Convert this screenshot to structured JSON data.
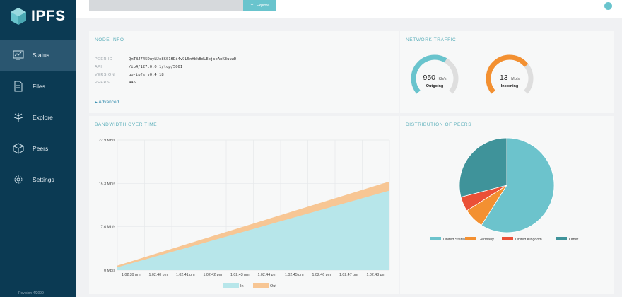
{
  "app": {
    "name": "IPFS",
    "footer": "Revision 4f2099"
  },
  "nav": [
    {
      "id": "status",
      "label": "Status",
      "icon": "monitor-icon",
      "active": true
    },
    {
      "id": "files",
      "label": "Files",
      "icon": "file-icon",
      "active": false
    },
    {
      "id": "explore",
      "label": "Explore",
      "icon": "tree-icon",
      "active": false
    },
    {
      "id": "peers",
      "label": "Peers",
      "icon": "cube-icon",
      "active": false
    },
    {
      "id": "settings",
      "label": "Settings",
      "icon": "gear-icon",
      "active": false
    }
  ],
  "topbar": {
    "search_value": "",
    "explore_label": "Explore"
  },
  "node_info": {
    "title": "Node Info",
    "rows": [
      {
        "key": "Peer ID",
        "value": "QmTBJ745DuyNJo8SS1HDi4v9L5nHbkBdLEojseAnK3uuwD"
      },
      {
        "key": "API",
        "value": "/ip4/127.0.0.1/tcp/5001"
      },
      {
        "key": "Version",
        "value": "go-ipfs v0.4.18"
      },
      {
        "key": "Peers",
        "value": "445"
      }
    ],
    "advanced_label": "Advanced"
  },
  "traffic": {
    "title": "Network Traffic",
    "gauges": [
      {
        "value": "950",
        "unit": "Kb/s",
        "label": "Outgoing",
        "fill": 0.62,
        "color": "#69c4cd"
      },
      {
        "value": "13",
        "unit": "Mb/s",
        "label": "Incoming",
        "fill": 0.7,
        "color": "#f39031"
      }
    ]
  },
  "bandwidth": {
    "title": "Bandwidth over time",
    "legend": [
      {
        "label": "In",
        "color": "#b7e6ea"
      },
      {
        "label": "Out",
        "color": "#f7c694"
      }
    ]
  },
  "distribution": {
    "title": "Distribution of peers"
  },
  "chart_data": [
    {
      "type": "area",
      "title": "Bandwidth over time",
      "x": [
        "1:02:39 pm",
        "1:02:40 pm",
        "1:02:41 pm",
        "1:02:42 pm",
        "1:02:43 pm",
        "1:02:44 pm",
        "1:02:45 pm",
        "1:02:46 pm",
        "1:02:47 pm",
        "1:02:48 pm"
      ],
      "y_ticks": [
        "0 Mb/s",
        "7.6 Mb/s",
        "15.3 Mb/s",
        "22.9 Mb/s"
      ],
      "ylim": [
        0,
        22.9
      ],
      "series": [
        {
          "name": "In",
          "color": "#b7e6ea",
          "start": 0.5,
          "end": 14.0
        },
        {
          "name": "Out",
          "color": "#f7c694",
          "start": 0.8,
          "end": 15.6
        }
      ],
      "stacked": false,
      "legend_position": "bottom"
    },
    {
      "type": "pie",
      "title": "Distribution of peers",
      "slices": [
        {
          "label": "United States",
          "value": 59,
          "color": "#6cc3cc"
        },
        {
          "label": "Germany",
          "value": 7,
          "color": "#f39031"
        },
        {
          "label": "United Kingdom",
          "value": 5,
          "color": "#ea5037"
        },
        {
          "label": "Other",
          "value": 29,
          "color": "#3f939a"
        }
      ],
      "legend_position": "bottom"
    }
  ]
}
